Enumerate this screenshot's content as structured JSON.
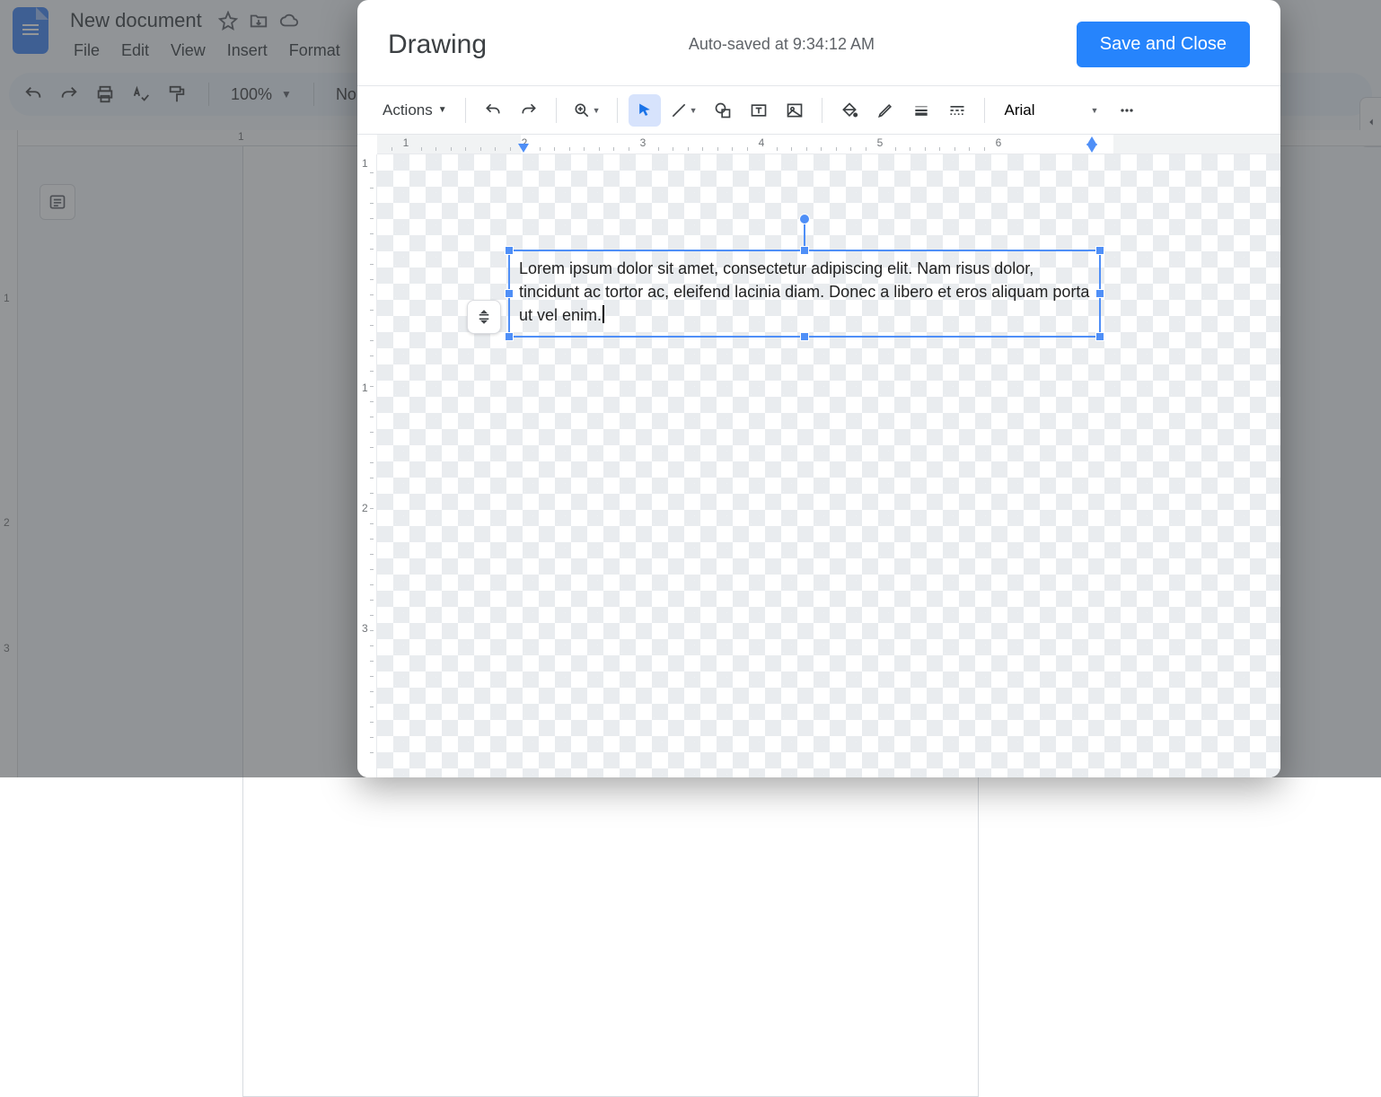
{
  "docs": {
    "title": "New document",
    "menus": [
      "File",
      "Edit",
      "View",
      "Insert",
      "Format"
    ],
    "toolbar": {
      "zoom": "100%",
      "style": "Norm"
    },
    "top_ruler_mark": "1",
    "left_ruler": [
      "1",
      "2",
      "3"
    ]
  },
  "modal": {
    "title": "Drawing",
    "autosave": "Auto-saved at 9:34:12 AM",
    "save_label": "Save and Close",
    "actions_label": "Actions",
    "font": "Arial",
    "h_ruler_nums": [
      "1",
      "2",
      "3",
      "4",
      "5",
      "6"
    ],
    "v_ruler_nums": [
      "1",
      "1",
      "2",
      "3"
    ],
    "textbox_text": "Lorem ipsum dolor sit amet, consectetur adipiscing elit. Nam risus dolor, tincidunt ac tortor ac, eleifend lacinia diam. Donec a libero et eros aliquam porta ut vel enim."
  }
}
